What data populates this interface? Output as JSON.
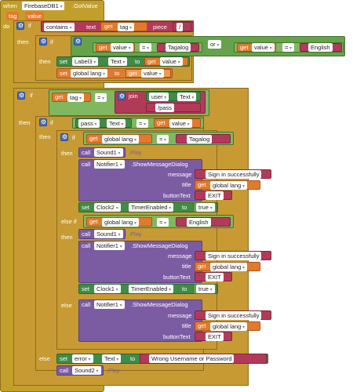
{
  "event": {
    "when": "when",
    "component": "FirebaseDB1",
    "event": ".GotValue",
    "param1": "tag",
    "param2": "value",
    "do": "do"
  },
  "kw": {
    "if": "if",
    "then": "then",
    "else": "else",
    "else_if": "else if",
    "set": "set",
    "get": "get",
    "call": "call",
    "to": "to",
    "or": "or",
    "join": "join",
    "eq": "=",
    "q": "“",
    "qe": "”"
  },
  "outer_if1": {
    "contains": "contains",
    "text": "text",
    "tag": "tag",
    "piece": "piece",
    "slash": "/",
    "value": "value",
    "tagalog": "Tagalog",
    "english": "English",
    "label_comp": "Label3",
    "prop_text": "Text",
    "global_lang": "global lang"
  },
  "outer_if2": {
    "tag": "tag",
    "user_comp": "user",
    "prop_text": "Text",
    "pass_str": "/pass",
    "pass_comp": "pass",
    "value": "value",
    "global_lang": "global lang",
    "tagalog": "Tagalog",
    "english": "English",
    "sound1": "Sound1",
    "sound2": "Sound2",
    "play": ".Play",
    "notifier": "Notifier1",
    "show_dialog": ".ShowMessageDialog",
    "message": "message",
    "title": "title",
    "button_text": "buttonText",
    "success_msg": "Sign in successfully",
    "exit": "EXIT",
    "clock2": "Clock2",
    "clock1": "Clock1",
    "timer_enabled": "TimerEnabled",
    "true_val": "true",
    "error_comp": "error",
    "wrong_msg": "Wrong Username or Password"
  },
  "colors": {
    "event": "#c29f2a",
    "control": "#c79a34",
    "procedure": "#7b5ca3",
    "variable": "#e27a2d",
    "text": "#b23a59",
    "logic": "#66a24a",
    "component": "#3e8c46"
  }
}
